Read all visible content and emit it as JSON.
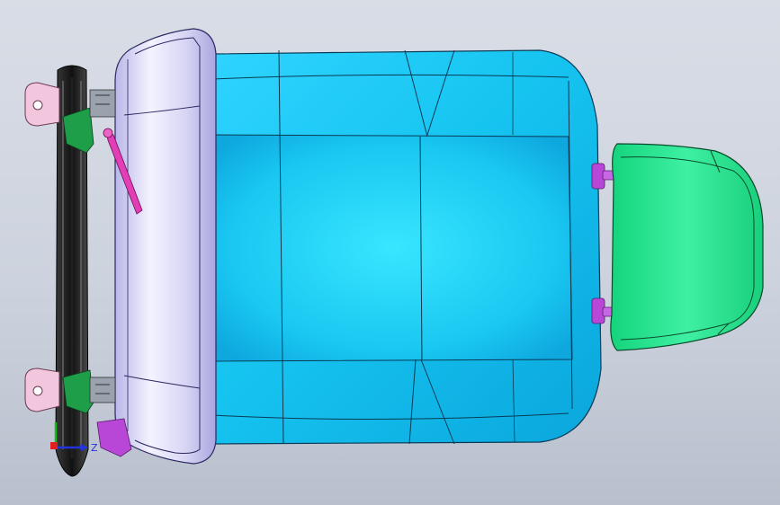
{
  "viewport": {
    "background_top": "#d9dde6",
    "background_bottom": "#b9c0cd"
  },
  "model": {
    "parts": [
      {
        "name": "seat-cushion",
        "color": "#1fc4ef"
      },
      {
        "name": "seat-back",
        "color": "#c9c7ee"
      },
      {
        "name": "headrest",
        "color": "#22e28b"
      },
      {
        "name": "seat-rail",
        "color": "#2a2a2a"
      },
      {
        "name": "rail-brackets",
        "color": "#f2c6dc"
      },
      {
        "name": "recliner-hinges",
        "color": "#1f9e4a"
      },
      {
        "name": "recline-lever",
        "color": "#e23fb7"
      },
      {
        "name": "headrest-guides",
        "color": "#b847d8"
      }
    ]
  },
  "triad": {
    "z_label": "Z",
    "x_color": "#e02020",
    "y_color": "#18b818",
    "z_color": "#2233dd"
  }
}
